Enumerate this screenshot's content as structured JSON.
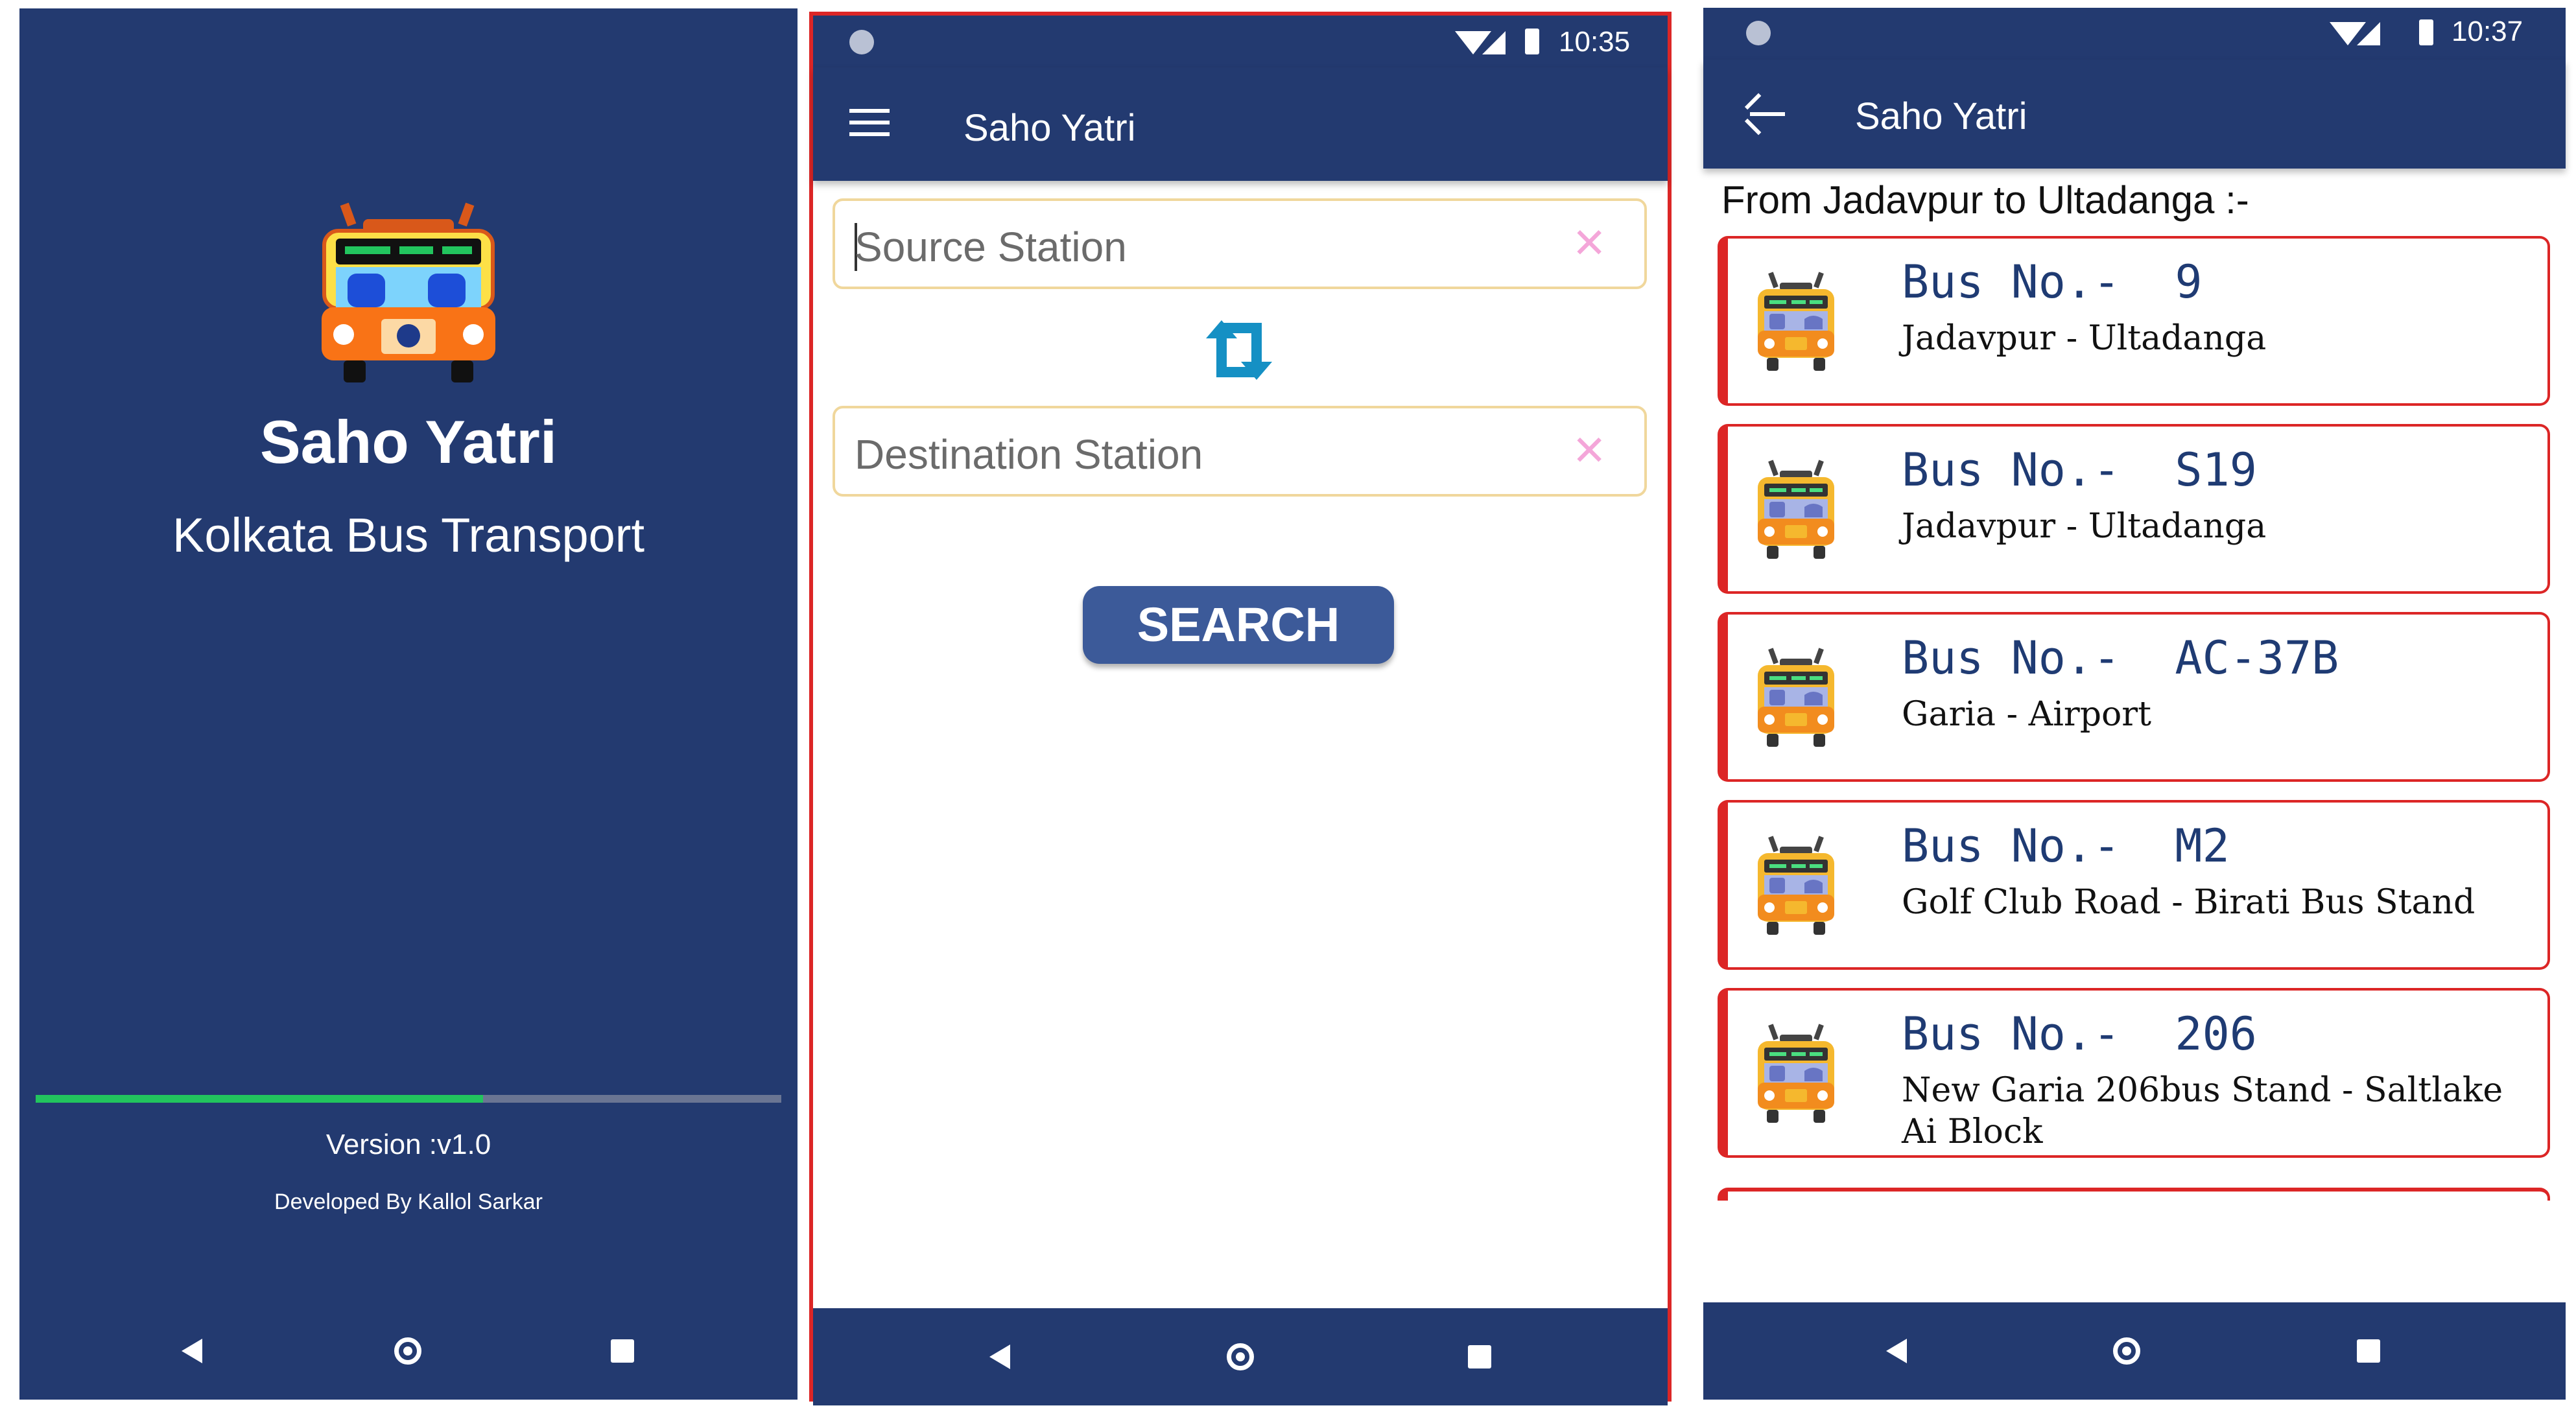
{
  "splash": {
    "app_name": "Saho Yatri",
    "subtitle": "Kolkata Bus Transport",
    "progress": 0.6,
    "version": "Version :v1.0",
    "developer": "Developed By Kallol Sarkar"
  },
  "search_screen": {
    "status_time": "10:35",
    "toolbar_title": "Saho Yatri",
    "source_placeholder": "Source Station",
    "destination_placeholder": "Destination Station",
    "clear_glyph": "✕",
    "search_label": "SEARCH"
  },
  "results_screen": {
    "status_time": "10:37",
    "toolbar_title": "Saho Yatri",
    "route_heading": "From Jadavpur to Ultadanga :-",
    "results": [
      {
        "bus_no": "Bus No.- 9",
        "route": "Jadavpur - Ultadanga"
      },
      {
        "bus_no": "Bus No.- S19",
        "route": "Jadavpur - Ultadanga"
      },
      {
        "bus_no": "Bus No.- AC-37B",
        "route": "Garia - Airport"
      },
      {
        "bus_no": "Bus No.- M2",
        "route": "Golf Club Road - Birati Bus Stand"
      },
      {
        "bus_no": "Bus No.- 206",
        "route": "New Garia 206bus Stand - Saltlake Ai Block"
      }
    ]
  },
  "colors": {
    "primary": "#233a70",
    "accent_button": "#3c5a99",
    "card_border": "#dc2626",
    "progress": "#22c55e",
    "input_border": "#f0d79c"
  },
  "icons": [
    "bus-icon",
    "menu-icon",
    "swap-icon",
    "clear-icon",
    "back-arrow-icon",
    "nav-back-icon",
    "nav-home-icon",
    "nav-recents-icon",
    "wifi-icon",
    "signal-icon",
    "battery-icon"
  ]
}
